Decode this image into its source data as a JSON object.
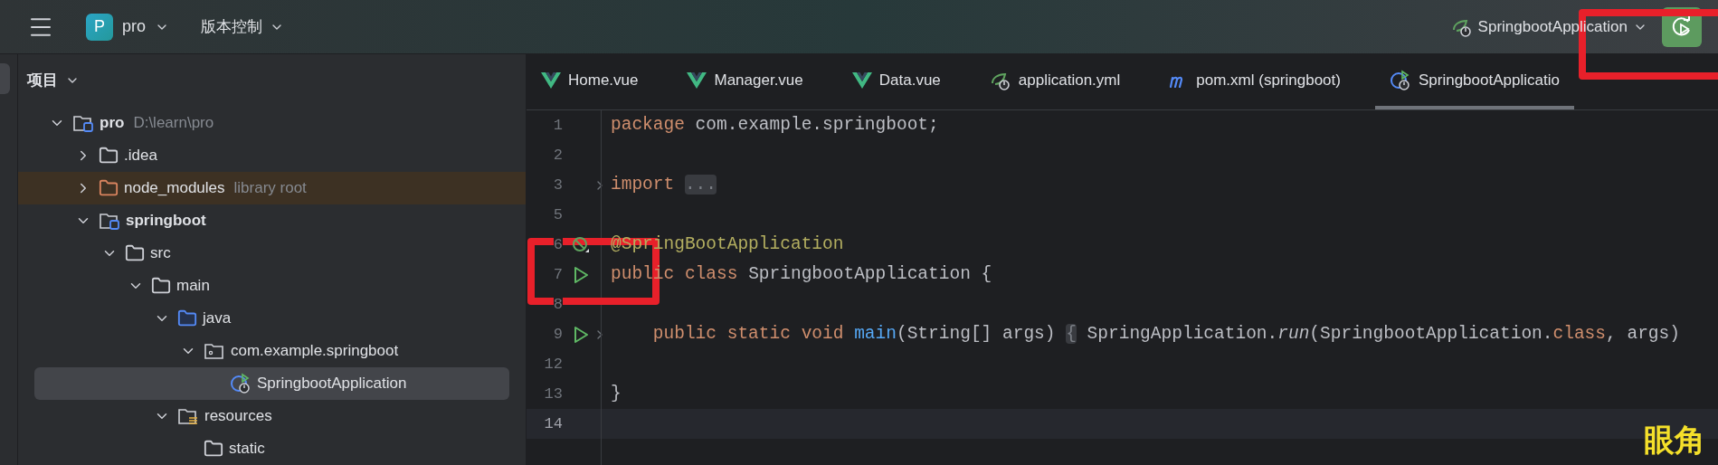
{
  "top_bar": {
    "project": {
      "letter": "P",
      "name": "pro"
    },
    "vcs": "版本控制",
    "run_config": "SpringbootApplication"
  },
  "project_panel": {
    "title": "项目",
    "tree": [
      {
        "label": "pro",
        "hint": "D:\\learn\\pro",
        "kind": "module",
        "expanded": true,
        "selected": false,
        "children": [
          {
            "label": ".idea",
            "kind": "folder",
            "expanded": false,
            "selected": false
          },
          {
            "label": "node_modules",
            "hint": "library root",
            "kind": "library",
            "expanded": false,
            "selected": false
          },
          {
            "label": "springboot",
            "kind": "module",
            "expanded": true,
            "selected": false,
            "children": [
              {
                "label": "src",
                "kind": "folder",
                "expanded": true,
                "selected": false,
                "children": [
                  {
                    "label": "main",
                    "kind": "folder",
                    "expanded": true,
                    "selected": false,
                    "children": [
                      {
                        "label": "java",
                        "kind": "source",
                        "expanded": true,
                        "selected": false,
                        "children": [
                          {
                            "label": "com.example.springboot",
                            "kind": "package",
                            "expanded": true,
                            "selected": false,
                            "children": [
                              {
                                "label": "SpringbootApplication",
                                "kind": "class",
                                "selected": true
                              }
                            ]
                          }
                        ]
                      },
                      {
                        "label": "resources",
                        "kind": "resources",
                        "expanded": true,
                        "selected": false,
                        "children": [
                          {
                            "label": "static",
                            "kind": "folder",
                            "selected": false
                          }
                        ]
                      }
                    ]
                  }
                ]
              }
            ]
          }
        ]
      }
    ]
  },
  "tabs": [
    {
      "label": "Home.vue",
      "kind": "vue",
      "selected": false
    },
    {
      "label": "Manager.vue",
      "kind": "vue",
      "selected": false
    },
    {
      "label": "Data.vue",
      "kind": "vue",
      "selected": false
    },
    {
      "label": "application.yml",
      "kind": "yml",
      "selected": false
    },
    {
      "label": "pom.xml (springboot)",
      "kind": "maven",
      "selected": false
    },
    {
      "label": "SpringbootApplicatio",
      "kind": "spring_class",
      "selected": true
    }
  ],
  "code": [
    {
      "number": "1",
      "tokens": [
        {
          "text": "package",
          "kind": "keyword"
        },
        {
          "text": " com.example.springboot;",
          "kind": "plain"
        }
      ]
    },
    {
      "number": "2"
    },
    {
      "number": "3",
      "fold": true,
      "tokens": [
        {
          "text": "import ",
          "kind": "keyword"
        },
        {
          "text": "...",
          "kind": "folded"
        }
      ]
    },
    {
      "number": "5"
    },
    {
      "number": "6",
      "bean": true,
      "tokens": [
        {
          "text": "@SpringBootApplication",
          "kind": "annotation"
        }
      ]
    },
    {
      "number": "7",
      "run": true,
      "tokens": [
        {
          "text": "public class",
          "kind": "keyword"
        },
        {
          "text": " SpringbootApplication {",
          "kind": "plain"
        }
      ]
    },
    {
      "number": "8"
    },
    {
      "number": "9",
      "run": true,
      "fold": true,
      "tokens": [
        {
          "text": "    public static void ",
          "kind": "keyword"
        },
        {
          "text": "main",
          "kind": "function"
        },
        {
          "text": "(String[] args) ",
          "kind": "plain"
        },
        {
          "text": "{",
          "kind": "folded"
        },
        {
          "text": " SpringApplication.",
          "kind": "plain"
        },
        {
          "text": "run",
          "kind": "static_call"
        },
        {
          "text": "(SpringbootApplication.",
          "kind": "plain"
        },
        {
          "text": "class",
          "kind": "keyword"
        },
        {
          "text": ", args)",
          "kind": "plain"
        }
      ]
    },
    {
      "number": "12"
    },
    {
      "number": "13",
      "tokens": [
        {
          "text": "}",
          "kind": "plain"
        }
      ]
    },
    {
      "number": "14",
      "current": true
    }
  ],
  "caption": "眼角"
}
